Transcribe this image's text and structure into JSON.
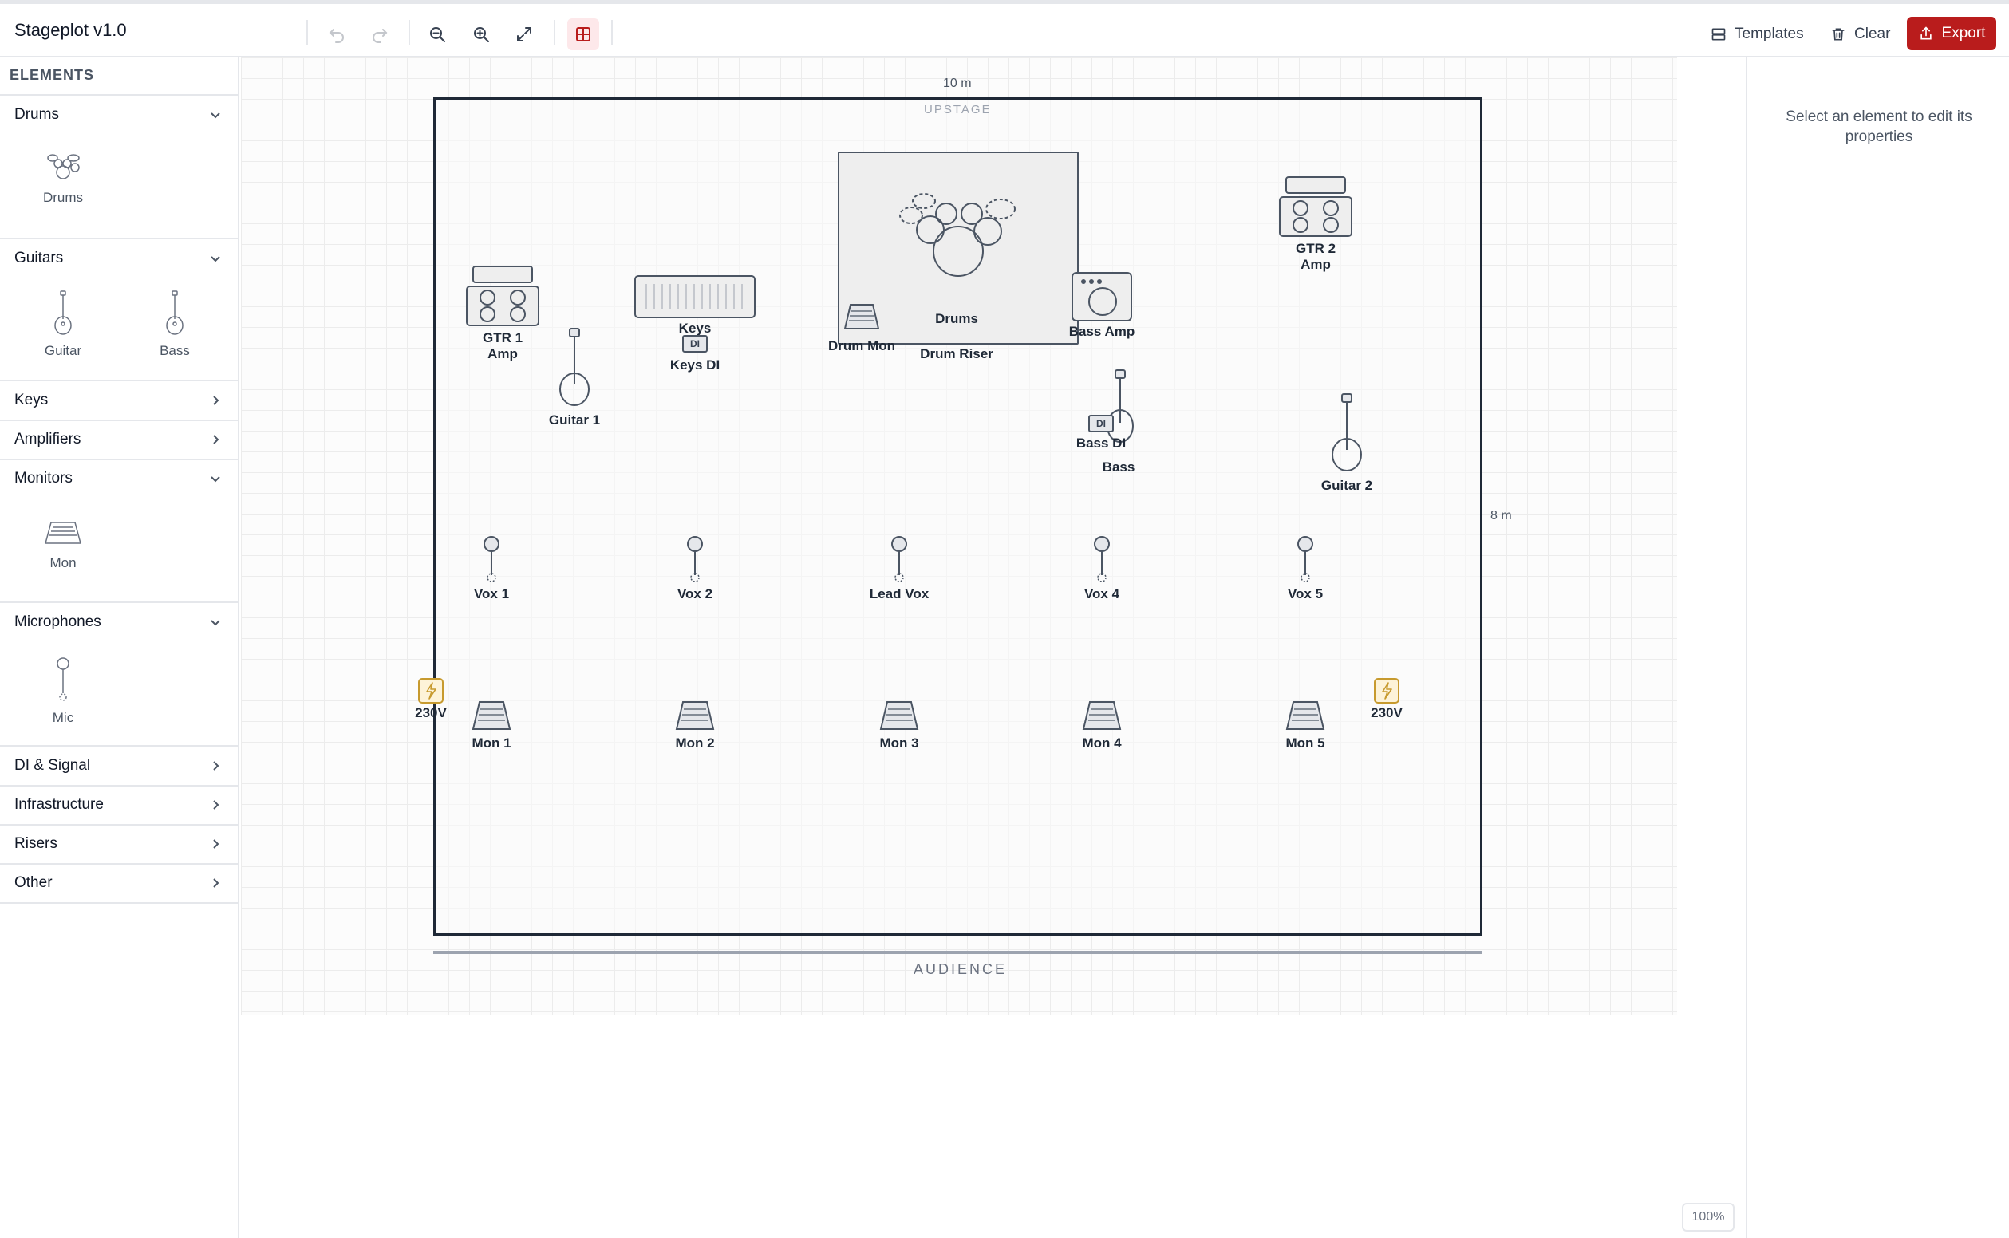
{
  "app": {
    "title": "Stageplot v1.0"
  },
  "toolbar": {
    "templates_label": "Templates",
    "clear_label": "Clear",
    "export_label": "Export",
    "icons": [
      "undo-icon",
      "redo-icon",
      "zoom-out-icon",
      "zoom-in-icon",
      "fit-icon",
      "grid-icon"
    ],
    "grid_active": true,
    "accent": "#b91c1c"
  },
  "sidebar": {
    "header": "ELEMENTS",
    "categories": [
      {
        "label": "Drums",
        "expanded": true,
        "items": [
          {
            "label": "Drums",
            "icon": "drums-icon"
          }
        ]
      },
      {
        "label": "Guitars",
        "expanded": true,
        "items": [
          {
            "label": "Guitar",
            "icon": "guitar-icon"
          },
          {
            "label": "Bass",
            "icon": "bass-icon"
          }
        ]
      },
      {
        "label": "Keys",
        "expanded": false
      },
      {
        "label": "Amplifiers",
        "expanded": false
      },
      {
        "label": "Monitors",
        "expanded": true,
        "items": [
          {
            "label": "Mon",
            "icon": "monitor-wedge-icon"
          }
        ]
      },
      {
        "label": "Microphones",
        "expanded": true,
        "items": [
          {
            "label": "Mic",
            "icon": "microphone-icon"
          }
        ]
      },
      {
        "label": "DI & Signal",
        "expanded": false
      },
      {
        "label": "Infrastructure",
        "expanded": false
      },
      {
        "label": "Risers",
        "expanded": false
      },
      {
        "label": "Other",
        "expanded": false
      }
    ]
  },
  "canvas": {
    "width_label": "10 m",
    "depth_label": "8 m",
    "upstage_label": "UPSTAGE",
    "audience_label": "AUDIENCE",
    "zoom": "100%",
    "elements": {
      "drum_riser": "Drum Riser",
      "drums": "Drums",
      "drum_mon": "Drum Mon",
      "gtr1_amp": "GTR 1\nAmp",
      "gtr2_amp": "GTR 2\nAmp",
      "keys": "Keys",
      "keys_di": "Keys DI",
      "bass_amp": "Bass Amp",
      "bass_di": "Bass DI",
      "bass": "Bass",
      "guitar1": "Guitar 1",
      "guitar2": "Guitar 2",
      "vox1": "Vox 1",
      "vox2": "Vox 2",
      "lead_vox": "Lead Vox",
      "vox4": "Vox 4",
      "vox5": "Vox 5",
      "mon1": "Mon 1",
      "mon2": "Mon 2",
      "mon3": "Mon 3",
      "mon4": "Mon 4",
      "mon5": "Mon 5",
      "power_left": "230V",
      "power_right": "230V",
      "di_badge": "DI"
    },
    "colors": {
      "power": "#c79a2e",
      "power_fill": "#fdf3d8"
    }
  },
  "properties": {
    "empty_text": "Select an element to edit its properties"
  }
}
